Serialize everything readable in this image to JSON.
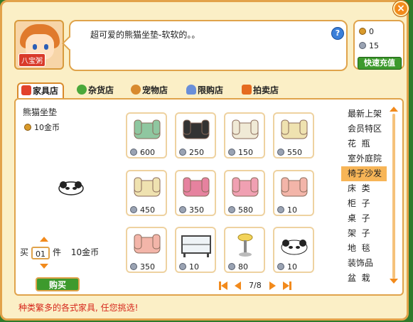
{
  "npc": {
    "tag": "八宝粥"
  },
  "speech": {
    "text": "超可爱的熊猫坐垫-软软的。。"
  },
  "wallet": {
    "gold": "0",
    "silver": "15",
    "recharge": "快速充值"
  },
  "tabs": [
    {
      "label": "家具店",
      "active": true
    },
    {
      "label": "杂货店"
    },
    {
      "label": "宠物店"
    },
    {
      "label": "限购店"
    },
    {
      "label": "拍卖店"
    }
  ],
  "detail": {
    "name": "熊猫坐垫",
    "price": "10金币",
    "qty_label": "买",
    "qty": "01",
    "unit": "件",
    "total": "10金币",
    "buy": "购买"
  },
  "items": [
    {
      "price": "600",
      "icon": "green-monster-chair-icon"
    },
    {
      "price": "250",
      "icon": "black-office-chair-icon"
    },
    {
      "price": "150",
      "icon": "white-armchair-icon"
    },
    {
      "price": "550",
      "icon": "beige-sofa-icon"
    },
    {
      "price": "450",
      "icon": "beige-couch-icon"
    },
    {
      "price": "350",
      "icon": "pink-armchair-icon"
    },
    {
      "price": "580",
      "icon": "pink-sofa-icon"
    },
    {
      "price": "10",
      "icon": "pink-checkered-chair-icon"
    },
    {
      "price": "350",
      "icon": "pink-checkered-armchair-icon"
    },
    {
      "price": "10",
      "icon": "glass-cabinet-icon"
    },
    {
      "price": "80",
      "icon": "yellow-table-icon"
    },
    {
      "price": "10",
      "icon": "panda-cushion-icon"
    }
  ],
  "categories": [
    "最新上架",
    "会员特区",
    "花  瓶",
    "室外庭院",
    "椅子沙发",
    "床  类",
    "柜  子",
    "桌  子",
    "架  子",
    "地  毯",
    "装饰品",
    "盆  栽"
  ],
  "selected_category": "椅子沙发",
  "pager": {
    "text": "7/8"
  },
  "footer": "种类繁多的各式家具, 任您挑选!"
}
